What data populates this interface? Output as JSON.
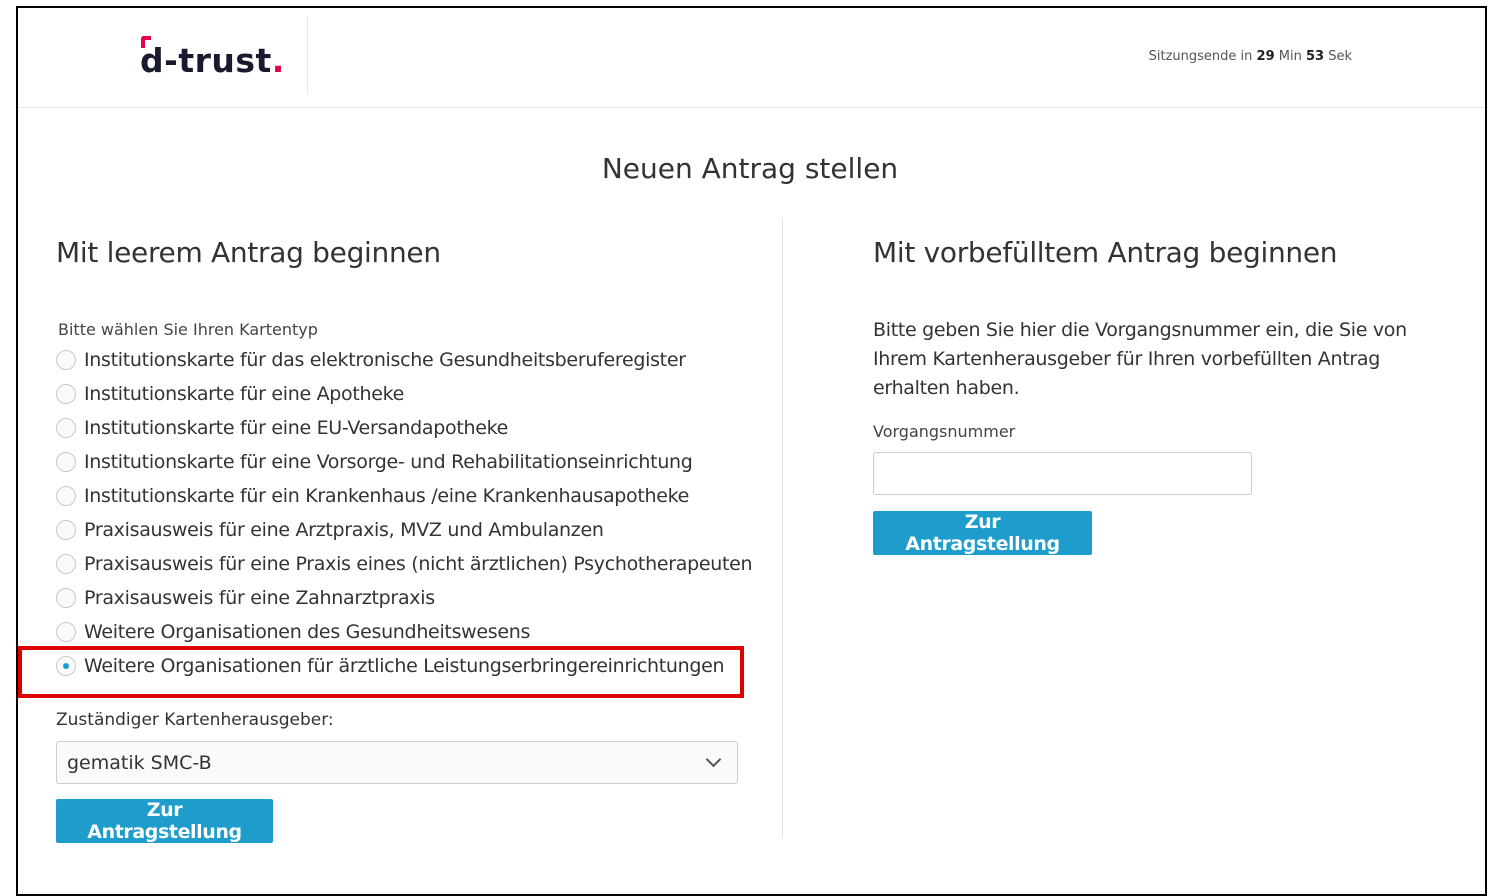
{
  "header": {
    "logo_text": "d-trust",
    "logo_dot": ".",
    "session_prefix": "Sitzungsende in",
    "session_minutes": "29",
    "session_min_label": "Min",
    "session_seconds": "53",
    "session_sec_label": "Sek"
  },
  "page_title": "Neuen Antrag stellen",
  "left": {
    "heading": "Mit leerem Antrag beginnen",
    "card_type_label": "Bitte wählen Sie Ihren Kartentyp",
    "options": [
      {
        "label": "Institutionskarte für das elektronische Gesundheitsberuferegister",
        "checked": false
      },
      {
        "label": "Institutionskarte für eine Apotheke",
        "checked": false
      },
      {
        "label": "Institutionskarte für eine EU-Versandapotheke",
        "checked": false
      },
      {
        "label": "Institutionskarte für eine Vorsorge- und Rehabilitationseinrichtung",
        "checked": false
      },
      {
        "label": "Institutionskarte für ein Krankenhaus /eine Krankenhausapotheke",
        "checked": false
      },
      {
        "label": "Praxisausweis für eine Arztpraxis, MVZ und Ambulanzen",
        "checked": false
      },
      {
        "label": "Praxisausweis für eine Praxis eines (nicht ärztlichen) Psychotherapeuten",
        "checked": false
      },
      {
        "label": "Praxisausweis für eine Zahnarztpraxis",
        "checked": false
      },
      {
        "label": "Weitere Organisationen des Gesundheitswesens",
        "checked": false
      },
      {
        "label": "Weitere Organisationen für ärztliche Leistungserbringereinrichtungen",
        "checked": true
      }
    ],
    "issuer_label": "Zuständiger Kartenherausgeber:",
    "issuer_selected": "gematik SMC-B",
    "submit_label": "Zur Antragstellung"
  },
  "right": {
    "heading": "Mit vorbefülltem Antrag beginnen",
    "description": "Bitte geben Sie hier die Vorgangsnummer ein, die Sie von Ihrem Kartenherausgeber für Ihren vorbefüllten Antrag erhalten haben.",
    "field_label": "Vorgangsnummer",
    "field_value": "",
    "submit_label": "Zur Antragstellung"
  },
  "colors": {
    "accent": "#1e9dcc",
    "logo_red": "#e2004f",
    "highlight": "#e00000"
  }
}
